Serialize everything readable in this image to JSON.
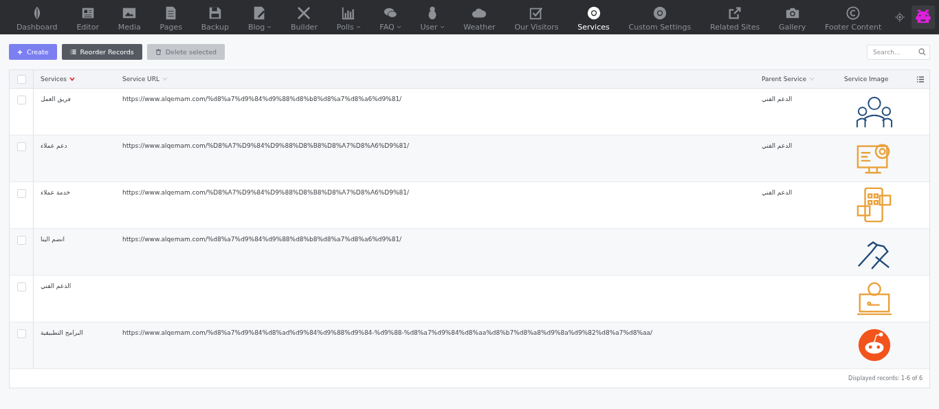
{
  "nav": {
    "items": [
      {
        "label": "Dashboard",
        "selected": false,
        "has_menu": false
      },
      {
        "label": "Editor",
        "selected": false,
        "has_menu": false
      },
      {
        "label": "Media",
        "selected": false,
        "has_menu": false
      },
      {
        "label": "Pages",
        "selected": false,
        "has_menu": false
      },
      {
        "label": "Backup",
        "selected": false,
        "has_menu": false
      },
      {
        "label": "Blog",
        "selected": false,
        "has_menu": true
      },
      {
        "label": "Builder",
        "selected": false,
        "has_menu": false
      },
      {
        "label": "Polls",
        "selected": false,
        "has_menu": true
      },
      {
        "label": "FAQ",
        "selected": false,
        "has_menu": true
      },
      {
        "label": "User",
        "selected": false,
        "has_menu": true
      },
      {
        "label": "Weather",
        "selected": false,
        "has_menu": false
      },
      {
        "label": "Our Visitors",
        "selected": false,
        "has_menu": false
      },
      {
        "label": "Services",
        "selected": true,
        "has_menu": false
      },
      {
        "label": "Custom Settings",
        "selected": false,
        "has_menu": false
      },
      {
        "label": "Related Sites",
        "selected": false,
        "has_menu": false
      },
      {
        "label": "Gallery",
        "selected": false,
        "has_menu": false
      },
      {
        "label": "Footer Content",
        "selected": false,
        "has_menu": false
      }
    ]
  },
  "toolbar": {
    "buttons": [
      {
        "label": "Create",
        "kind": "primary",
        "disabled": false
      },
      {
        "label": "Reorder Records",
        "kind": "secondary",
        "disabled": false
      },
      {
        "label": "Delete selected",
        "kind": "secondary",
        "disabled": true
      }
    ],
    "search": {
      "placeholder": "Search..."
    }
  },
  "table": {
    "all_checked": false,
    "columns": [
      {
        "label": "Services",
        "sorted": true
      },
      {
        "label": "Service URL",
        "sorted": false
      },
      {
        "label": "Parent Service",
        "sorted": false
      },
      {
        "label": "Service Image"
      }
    ],
    "rows": [
      {
        "checked": false,
        "service": "فريق العمل",
        "url": "https://www.alqemam.com/%d8%a7%d9%84%d9%88%d8%b8%d8%a7%d8%a6%d9%81/",
        "parent": "الدعم الفني"
      },
      {
        "checked": false,
        "service": "دعم عملاء",
        "url": "https://www.alqemam.com/%D8%A7%D9%84%D9%88%D8%B8%D8%A7%D8%A6%D9%81/",
        "parent": "الدعم الفني"
      },
      {
        "checked": false,
        "service": "خدمة عملاء",
        "url": "https://www.alqemam.com/%D8%A7%D9%84%D9%88%D8%B8%D8%A7%D8%A6%D9%81/",
        "parent": "الدعم الفني"
      },
      {
        "checked": false,
        "service": "انضم الينا",
        "url": "https://www.alqemam.com/%d8%a7%d9%84%d9%88%d8%b8%d8%a7%d8%a6%d9%81/",
        "parent": ""
      },
      {
        "checked": false,
        "service": "الدعم الفني",
        "url": "",
        "parent": ""
      },
      {
        "checked": false,
        "service": "البرامج التطبيقية",
        "url": "https://www.alqemam.com/%d8%a7%d9%84%d8%ad%d9%84%d9%88%d9%84-%d9%88-%d8%a7%d9%84%d8%aa%d8%b7%d8%a8%d9%8a%d9%82%d8%a7%d8%aa/",
        "parent": ""
      }
    ],
    "footer": "Displayed records: 1-6 of 6"
  }
}
